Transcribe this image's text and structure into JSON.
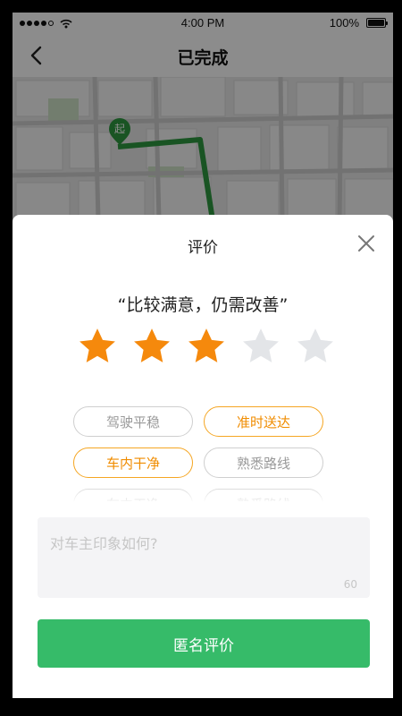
{
  "status_bar": {
    "time": "4:00 PM",
    "battery": "100%"
  },
  "nav": {
    "title": "已完成"
  },
  "map": {
    "start_marker": "起",
    "route_color": "#2e9a41"
  },
  "rating": {
    "title": "评价",
    "quote": "“比较满意，仍需改善”",
    "stars_total": 5,
    "stars_selected": 3,
    "star_color": "#f5890c",
    "star_empty_color": "#e3e5e8"
  },
  "tags": [
    {
      "label": "驾驶平稳",
      "selected": false
    },
    {
      "label": "准时送达",
      "selected": true
    },
    {
      "label": "车内干净",
      "selected": true
    },
    {
      "label": "熟悉路线",
      "selected": false
    },
    {
      "label": "车内干净",
      "selected": false
    },
    {
      "label": "熟悉路线",
      "selected": false
    }
  ],
  "comment": {
    "placeholder": "对车主印象如何?",
    "counter": "60"
  },
  "submit_label": "匿名评价",
  "colors": {
    "accent_orange": "#f5a623",
    "button_green": "#36bb69"
  }
}
